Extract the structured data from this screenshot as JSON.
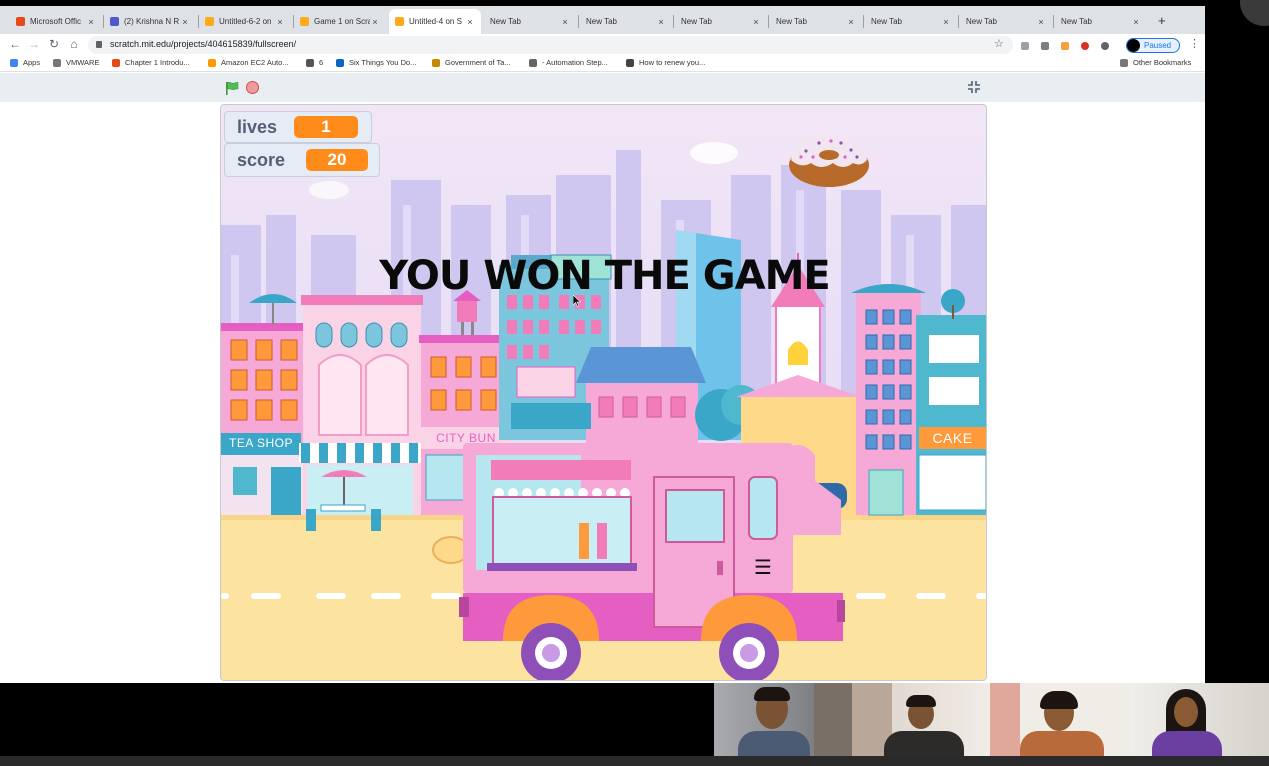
{
  "browser": {
    "tabs": [
      {
        "label": "Microsoft Offic",
        "favicon_color": "#e64a19",
        "active": false
      },
      {
        "label": "(2) Krishna N R",
        "favicon_color": "#5059c9",
        "active": false
      },
      {
        "label": "Untitled-6-2 on",
        "favicon_color": "#ffab19",
        "active": false
      },
      {
        "label": "Game 1 on Scra",
        "favicon_color": "#ffab19",
        "active": false
      },
      {
        "label": "Untitled-4 on S",
        "favicon_color": "#ffab19",
        "active": true
      },
      {
        "label": "New Tab",
        "favicon_color": "",
        "active": false
      },
      {
        "label": "New Tab",
        "favicon_color": "",
        "active": false
      },
      {
        "label": "New Tab",
        "favicon_color": "",
        "active": false
      },
      {
        "label": "New Tab",
        "favicon_color": "",
        "active": false
      },
      {
        "label": "New Tab",
        "favicon_color": "",
        "active": false
      },
      {
        "label": "New Tab",
        "favicon_color": "",
        "active": false
      },
      {
        "label": "New Tab",
        "favicon_color": "",
        "active": false
      }
    ],
    "tab_close": "×",
    "new_tab": "+",
    "nav": {
      "back": "←",
      "forward": "→",
      "reload": "↻",
      "home": "⌂"
    },
    "url": "scratch.mit.edu/projects/404615839/fullscreen/",
    "star": "☆",
    "profile_status": "Paused",
    "menu": "⋮",
    "bookmarks": [
      {
        "label": "Apps",
        "icon_color": "#4285f4"
      },
      {
        "label": "VMWARE",
        "icon_color": "#777777"
      },
      {
        "label": "Chapter 1 Introdu...",
        "icon_color": "#e64a19"
      },
      {
        "label": "Amazon EC2 Auto...",
        "icon_color": "#ff9900"
      },
      {
        "label": "6",
        "icon_color": "#555555"
      },
      {
        "label": "Six Things You Do...",
        "icon_color": "#0a66c2"
      },
      {
        "label": "Government of Ta...",
        "icon_color": "#c68a00"
      },
      {
        "label": "- Automation Step...",
        "icon_color": "#666666"
      },
      {
        "label": "How to renew you...",
        "icon_color": "#444444"
      }
    ],
    "other_bookmarks": "Other Bookmarks"
  },
  "scratch": {
    "monitors": [
      {
        "label": "lives",
        "value": "1"
      },
      {
        "label": "score",
        "value": "20"
      }
    ],
    "message": "YOU WON THE GAME",
    "signs": {
      "tea_shop": "TEA SHOP",
      "city_bun": "CITY BUN",
      "cake": "CAKE",
      "truck_menu": "☰"
    }
  },
  "colors": {
    "accent_orange": "#ff8c1a",
    "sky": "#e2dcf8",
    "road": "#fde3a0",
    "truck_pink": "#f6a8d6",
    "truck_magenta": "#e55fc2"
  }
}
